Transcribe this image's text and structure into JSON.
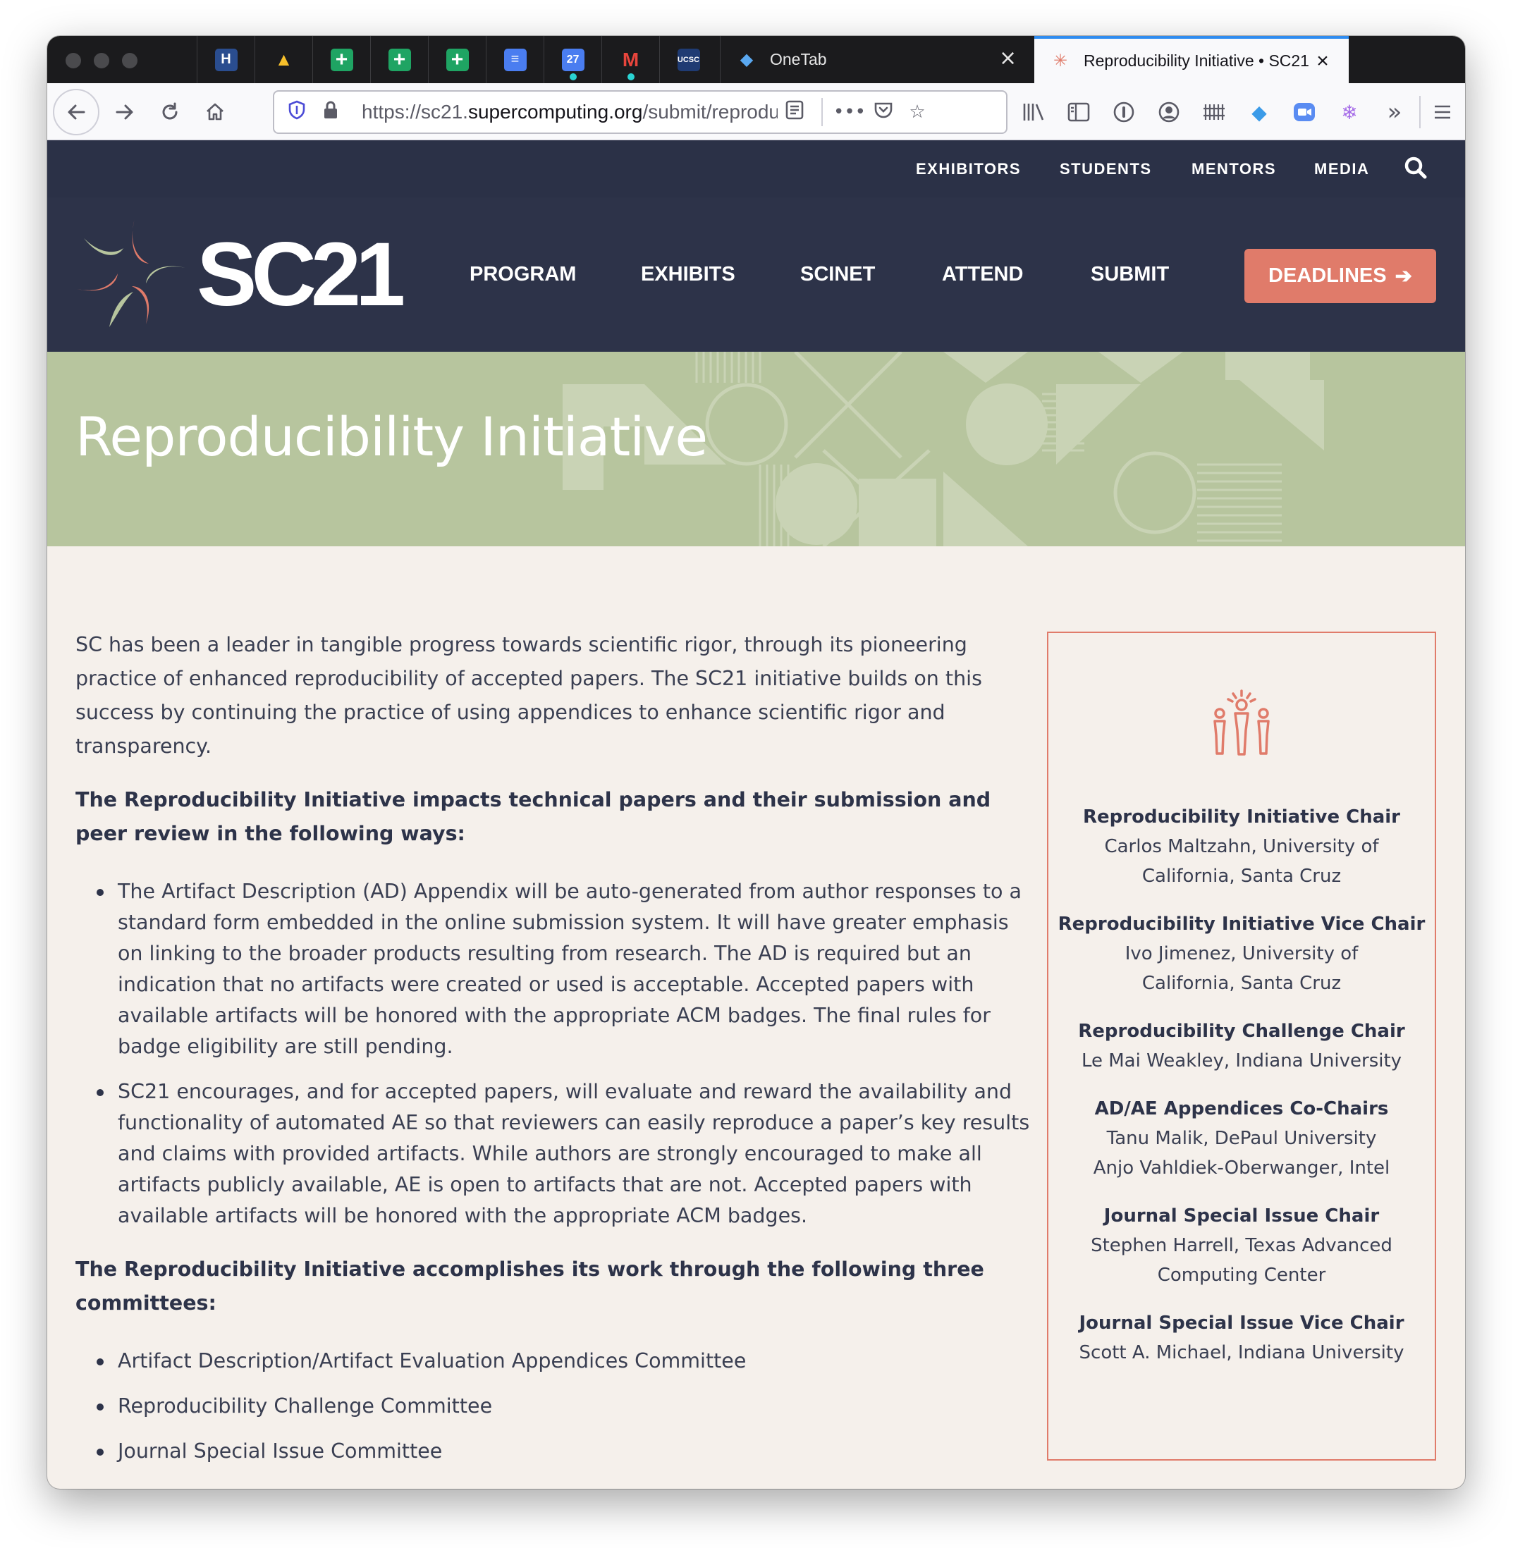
{
  "browser": {
    "tabs": [
      {
        "label": "OneTab",
        "icon": "diamond-icon"
      },
      {
        "label": "Reproducibility Initiative • SC21",
        "icon": "sc21-favicon",
        "active": true
      }
    ],
    "pinned_tabs": [
      {
        "icon": "app-icon",
        "text": "H"
      },
      {
        "icon": "google-drive-icon",
        "text": "▲"
      },
      {
        "icon": "google-sheets-icon",
        "text": "+"
      },
      {
        "icon": "google-sheets-icon",
        "text": "+"
      },
      {
        "icon": "google-sheets-icon",
        "text": "+"
      },
      {
        "icon": "google-docs-icon",
        "text": "≡"
      },
      {
        "icon": "google-calendar-icon",
        "text": "27"
      },
      {
        "icon": "gmail-icon",
        "text": "M"
      },
      {
        "icon": "ucsc-icon",
        "text": "UCSC"
      }
    ],
    "url": {
      "prefix": "https://sc21.",
      "domain": "supercomputing.org",
      "path": "/submit/reproducibility"
    },
    "close_glyph": "×"
  },
  "site": {
    "util_links": [
      "EXHIBITORS",
      "STUDENTS",
      "MENTORS",
      "MEDIA"
    ],
    "logo_text": "SC21",
    "nav_links": [
      "PROGRAM",
      "EXHIBITS",
      "SCINET",
      "ATTEND",
      "SUBMIT"
    ],
    "deadlines_label": "DEADLINES",
    "arrow_glyph": "➔",
    "colors": {
      "navy": "#2d3349",
      "coral": "#e07b6a",
      "sage": "#b7c59e",
      "cream": "#f5f0eb"
    }
  },
  "page": {
    "title": "Reproducibility Initiative",
    "intro": "SC has been a leader in tangible progress towards scientific rigor, through its pioneering practice of enhanced reproducibility of accepted papers. The SC21 initiative builds on this success by continuing the practice of using appendices to enhance scientific rigor and transparency.",
    "impacts_heading": "The Reproducibility Initiative impacts technical papers and their submission and peer review in the following ways:",
    "impacts": [
      "The Artifact Description (AD) Appendix will be auto-generated from author responses to a standard form embedded in the online submission system. It will have greater emphasis on linking to the broader products resulting from research. The AD is required but an indication that no artifacts were created or used is acceptable. Accepted papers with available artifacts will be honored with the appropriate ACM badges. The final rules for badge eligibility are still pending.",
      "SC21 encourages, and for accepted papers, will evaluate and reward the availability and functionality of automated AE so that reviewers can easily reproduce a paper’s key results and claims with provided artifacts. While authors are strongly encouraged to make all artifacts publicly available, AE is open to artifacts that are not. Accepted papers with available artifacts will be honored with the appropriate ACM badges."
    ],
    "committees_heading": "The Reproducibility Initiative accomplishes its work through the following three committees:",
    "committees": [
      "Artifact Description/Artifact Evaluation Appendices Committee",
      "Reproducibility Challenge Committee",
      "Journal Special Issue Committee"
    ]
  },
  "sidebar": {
    "icon": "people-group-icon",
    "roles": [
      {
        "title": "Reproducibility Initiative Chair",
        "names": "Carlos Maltzahn, University of California, Santa Cruz"
      },
      {
        "title": "Reproducibility Initiative Vice Chair",
        "names": "Ivo Jimenez, University of California, Santa Cruz"
      },
      {
        "title": "Reproducibility Challenge Chair",
        "names": "Le Mai Weakley, Indiana University"
      },
      {
        "title": "AD/AE Appendices Co-Chairs",
        "names": "Tanu Malik, DePaul University",
        "names2": "Anjo Vahldiek-Oberwanger, Intel"
      },
      {
        "title": "Journal Special Issue Chair",
        "names": "Stephen Harrell, Texas Advanced Computing Center"
      },
      {
        "title": "Journal Special Issue Vice Chair",
        "names": "Scott A. Michael, Indiana University"
      }
    ]
  }
}
